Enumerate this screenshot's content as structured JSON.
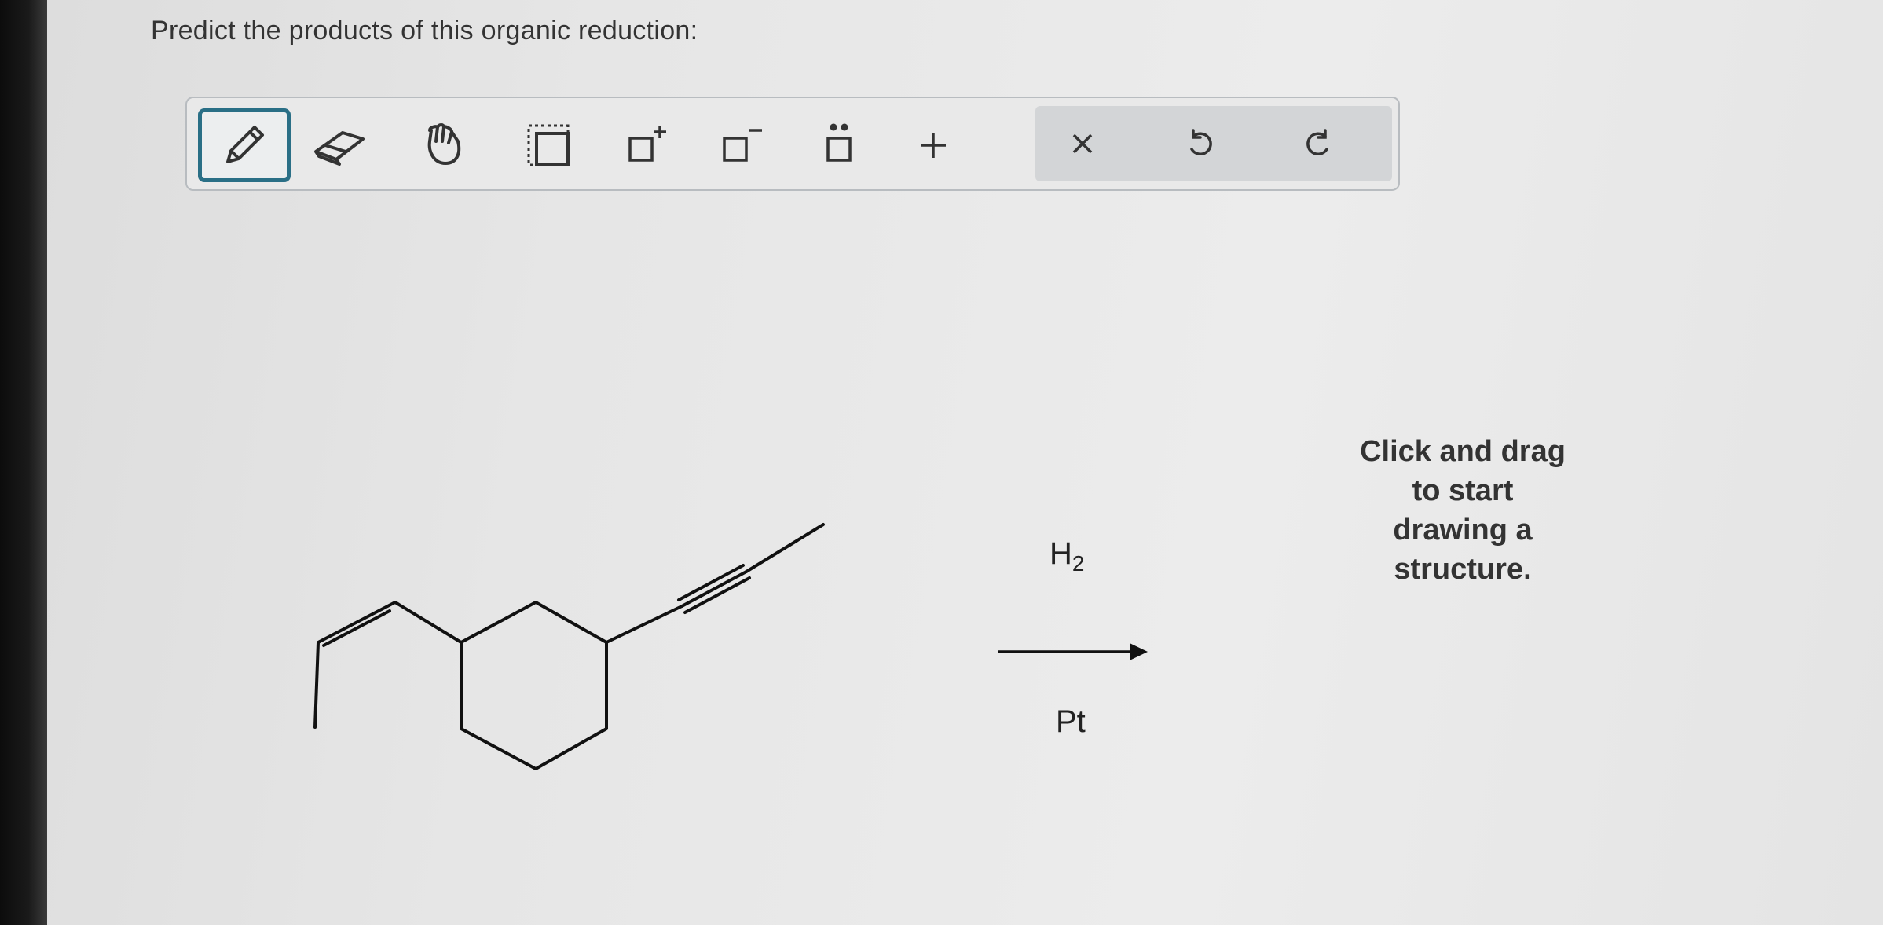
{
  "question": {
    "text": "Predict the products of this organic reduction:"
  },
  "toolbar": {
    "tools": [
      {
        "id": "pencil",
        "icon": "pencil-icon",
        "selected": true
      },
      {
        "id": "eraser",
        "icon": "eraser-icon"
      },
      {
        "id": "hand",
        "icon": "hand-icon"
      },
      {
        "id": "select",
        "icon": "marquee-select-icon"
      },
      {
        "id": "positive-charge",
        "icon": "positive-charge-icon",
        "symbol": "+"
      },
      {
        "id": "negative-charge",
        "icon": "negative-charge-icon",
        "symbol": "−"
      },
      {
        "id": "lone-pair",
        "icon": "lone-pair-icon"
      },
      {
        "id": "add",
        "icon": "plus-icon",
        "symbol": "+"
      }
    ],
    "actions": [
      {
        "id": "clear",
        "icon": "close-icon",
        "symbol": "×"
      },
      {
        "id": "undo",
        "icon": "undo-icon"
      },
      {
        "id": "redo",
        "icon": "redo-icon"
      }
    ]
  },
  "reaction": {
    "reagent_above": "H",
    "reagent_above_subscript": "2",
    "reagent_below": "Pt"
  },
  "canvas": {
    "hint_line1": "Click and drag to start",
    "hint_line2": "drawing a structure."
  }
}
